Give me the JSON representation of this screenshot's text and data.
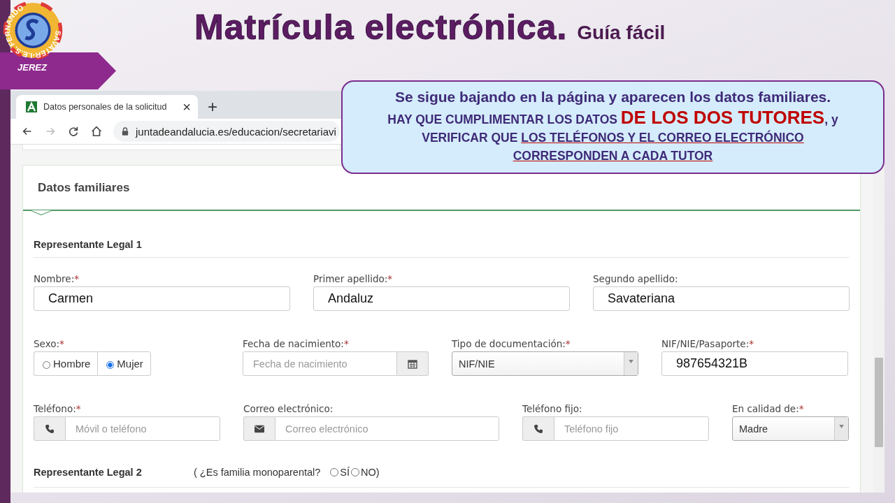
{
  "logo": {
    "ring_text": "SAVATER-I.E.S. FERNANDO",
    "city": "JEREZ"
  },
  "title": {
    "main": "Matrícula electrónica.",
    "sub": "Guía fácil"
  },
  "browser": {
    "tab": {
      "title": "Datos personales de la solicitud",
      "close": "×"
    },
    "new_tab": "+",
    "url": "juntadeandalucia.es/educacion/secretariavi"
  },
  "callout": {
    "heading": "Se sigue bajando en la página y aparecen los datos familiares.",
    "segments": [
      {
        "kind": "plain",
        "text": "HAY QUE CUMPLIMENTAR LOS DATOS "
      },
      {
        "kind": "highlight",
        "text": "DE LOS DOS TUTORES"
      },
      {
        "kind": "plain",
        "text": ", y VERIFICAR QUE "
      },
      {
        "kind": "underline",
        "text": "LOS TELÉFONOS Y EL CORREO ELECTRÓNICO CORRESPONDEN A CADA TUTOR"
      }
    ]
  },
  "section": {
    "title": "Datos familiares"
  },
  "representative_1": {
    "title": "Representante Legal 1",
    "rows": [
      [
        {
          "kind": "text",
          "label": "Nombre:",
          "mark": "*",
          "value": "Carmen"
        },
        {
          "kind": "text",
          "label": "Primer apellido:",
          "mark": "*",
          "value": "Andaluz"
        },
        {
          "kind": "text",
          "label": "Segundo apellido:",
          "value": "Savateriana"
        }
      ],
      [
        {
          "kind": "radio",
          "label": "Sexo:",
          "mark": "*",
          "options": [
            {
              "label": "Hombre",
              "selected": false
            },
            {
              "label": "Mujer",
              "selected": true
            }
          ]
        },
        {
          "kind": "date",
          "label": "Fecha de nacimiento:",
          "mark": "*",
          "placeholder": "Fecha de nacimiento"
        },
        {
          "kind": "select",
          "label": "Tipo de documentación:",
          "mark": "*",
          "value": "NIF/NIE"
        },
        {
          "kind": "text",
          "label": "NIF/NIE/Pasaporte:",
          "mark": "*",
          "value": "987654321B"
        }
      ],
      [
        {
          "kind": "phone",
          "label": "Teléfono:",
          "mark": "*",
          "placeholder": "Móvil o teléfono"
        },
        {
          "kind": "email",
          "label": "Correo electrónico:",
          "placeholder": "Correo electrónico"
        },
        {
          "kind": "phone",
          "label": "Teléfono fijo:",
          "placeholder": "Teléfono fijo"
        },
        {
          "kind": "select",
          "label": "En calidad de:",
          "mark": "*",
          "value": "Madre"
        }
      ]
    ]
  },
  "representative_2": {
    "title": "Representante Legal 2",
    "question": "( ¿Es familia monoparental?",
    "options": [
      {
        "label": "SÍ",
        "selected": false
      },
      {
        "label": "NO)",
        "selected": false
      }
    ]
  }
}
